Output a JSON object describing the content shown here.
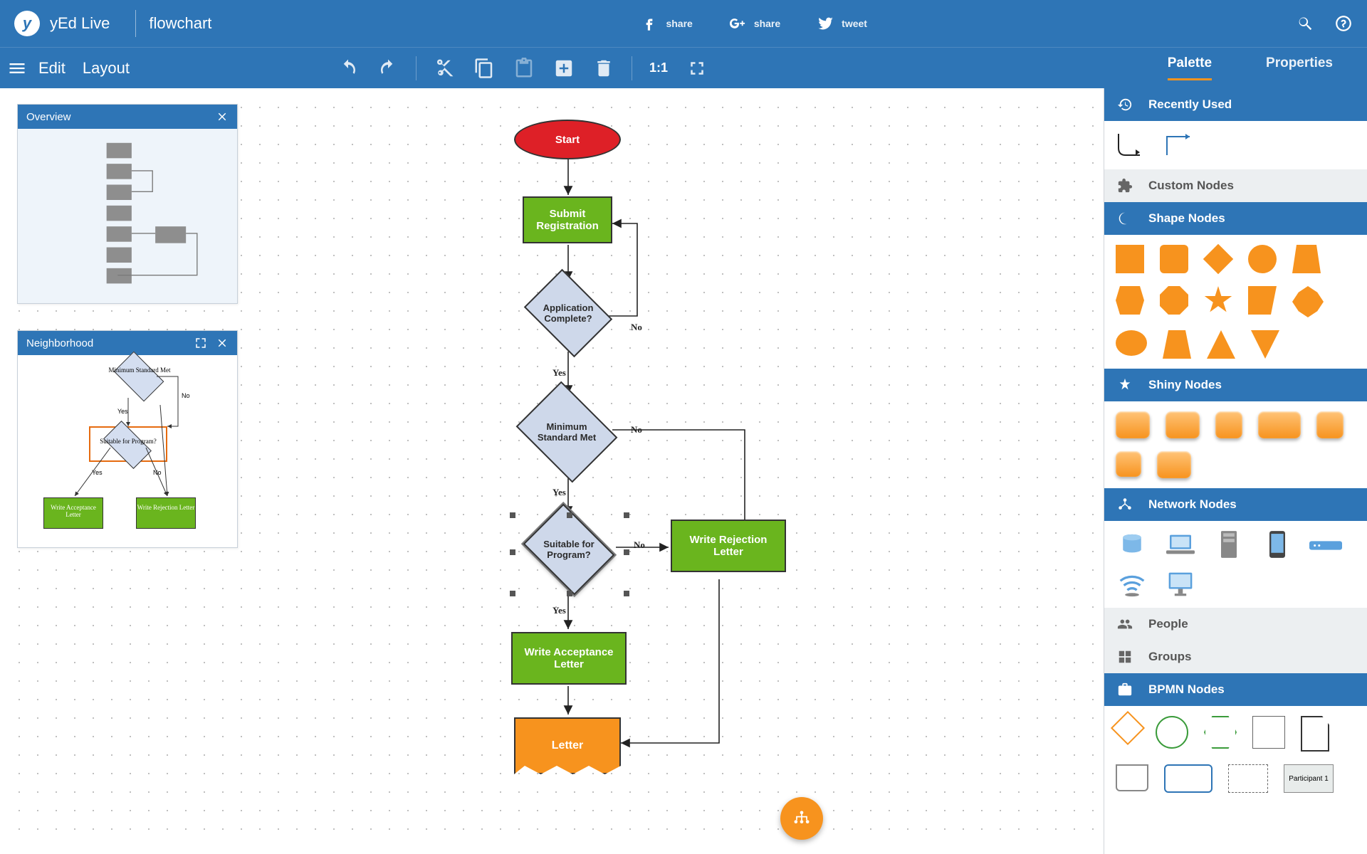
{
  "app": {
    "name": "yEd Live",
    "document": "flowchart"
  },
  "menu": {
    "edit": "Edit",
    "layout": "Layout"
  },
  "share": {
    "fb": "share",
    "gp": "share",
    "tw": "tweet"
  },
  "toolbar": {
    "fit": "1:1"
  },
  "tabs": {
    "palette": "Palette",
    "properties": "Properties"
  },
  "panels": {
    "overview": "Overview",
    "neighborhood": "Neighborhood",
    "neigh": {
      "d1": "Minimum Standard Met",
      "d2": "Suitable for Program?",
      "yes": "Yes",
      "no": "No",
      "acc": "Write Acceptance Letter",
      "rej": "Write Rejection Letter"
    }
  },
  "flow": {
    "start": "Start",
    "submit": "Submit Registration",
    "appcomplete": "Application Complete?",
    "minmet": "Minimum Standard Met",
    "suitable": "Suitable for Program?",
    "accletter": "Write Acceptance Letter",
    "rejletter": "Write Rejection Letter",
    "letter": "Letter",
    "yes": "Yes",
    "no": "No"
  },
  "palette": {
    "recent": "Recently Used",
    "custom": "Custom Nodes",
    "shape": "Shape Nodes",
    "shiny": "Shiny Nodes",
    "network": "Network Nodes",
    "people": "People",
    "groups": "Groups",
    "bpmn": "BPMN Nodes",
    "participant": "Participant 1"
  }
}
